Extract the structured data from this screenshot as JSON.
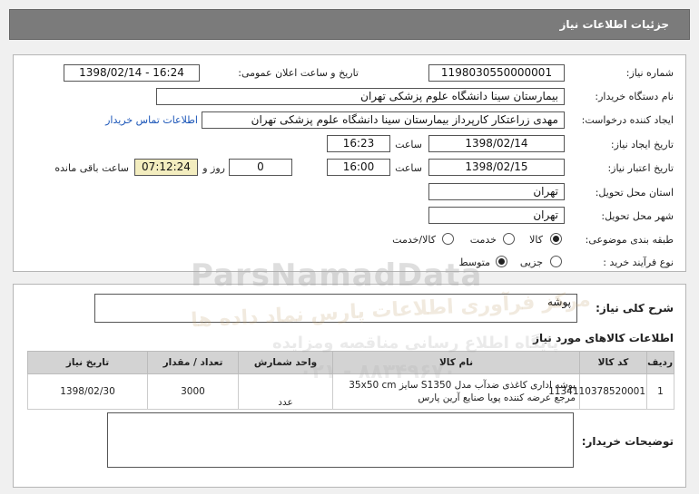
{
  "header": {
    "title": "جزئیات اطلاعات نیاز"
  },
  "form": {
    "need_number": {
      "label": "شماره نیاز:",
      "value": "1198030550000001"
    },
    "announce": {
      "label": "تاریخ و ساعت اعلان عمومی:",
      "value": "1398/02/14 - 16:24"
    },
    "buyer_org": {
      "label": "نام دستگاه خریدار:",
      "value": "بیمارستان سینا دانشگاه علوم پزشکی تهران"
    },
    "requester": {
      "label": "ایجاد کننده درخواست:",
      "value": "مهدی  زراعتکار  کارپرداز بیمارستان سینا دانشگاه علوم پزشکی تهران"
    },
    "contact_link": "اطلاعات تماس خریدار",
    "created": {
      "label": "تاریخ ایجاد نیاز:",
      "date": "1398/02/14",
      "time_label": "ساعت",
      "time": "16:23"
    },
    "validity": {
      "label": "تاریخ اعتبار نیاز:",
      "date": "1398/02/15",
      "time_label": "ساعت",
      "time": "16:00",
      "days": "0",
      "days_label": "روز و",
      "remaining": "07:12:24",
      "remaining_label": "ساعت باقی مانده"
    },
    "province": {
      "label": "استان محل تحویل:",
      "value": "تهران"
    },
    "city": {
      "label": "شهر محل تحویل:",
      "value": "تهران"
    },
    "category": {
      "label": "طبقه بندی موضوعی:",
      "options": [
        "کالا",
        "خدمت",
        "کالا/خدمت"
      ],
      "selected": "کالا"
    },
    "purchase_type": {
      "label": "نوع فرآیند خرید :",
      "options": [
        "جزیی",
        "متوسط"
      ],
      "selected": "متوسط"
    }
  },
  "summary": {
    "label": "شرح کلی نیاز:",
    "value": "پوشه"
  },
  "items": {
    "title": "اطلاعات کالاهای مورد نیاز",
    "columns": [
      "ردیف",
      "کد کالا",
      "نام کالا",
      "واحد شمارش",
      "تعداد / مقدار",
      "تاریخ نیاز"
    ],
    "rows": [
      {
        "index": "1",
        "code": "1134110378520001",
        "name": "پوشه اداری کاغذی ضدآب مدل S1350 سایز 35x50 cm مرجع عرضه کننده پویا صنایع آرین پارس",
        "unit": "عدد",
        "qty": "3000",
        "date": "1398/02/30"
      }
    ]
  },
  "buyer_notes": {
    "label": "توضیحات خریدار:",
    "value": ""
  },
  "watermark": {
    "line1": "ParsNamadData",
    "line2": "مرکز فرآوری اطلاعات پارس نماد داده ها",
    "line3": "پایگاه اطلاع رسانی مناقصه ومزایده",
    "line4": "۰۲۱ - ۸۸۳۴۹۶۷۰"
  },
  "colors": {
    "header_bg": "#7b7b7b",
    "link": "#1a55b8",
    "highlight": "#f3edbf",
    "table_header": "#d3d3d3"
  }
}
